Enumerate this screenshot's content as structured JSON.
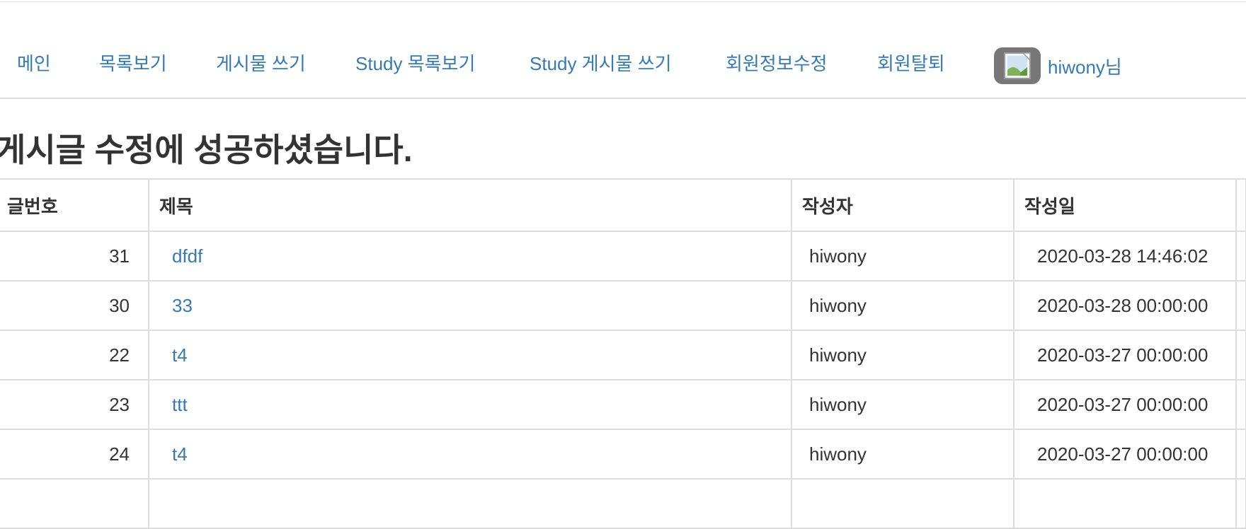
{
  "nav": {
    "items": [
      {
        "label": "메인"
      },
      {
        "label": "목록보기"
      },
      {
        "label": "게시물 쓰기"
      },
      {
        "label": "Study 목록보기"
      },
      {
        "label": "Study 게시물 쓰기"
      },
      {
        "label": "회원정보수정"
      },
      {
        "label": "회원탈퇴"
      }
    ],
    "user": {
      "name": "hiwony님",
      "avatar_icon": "broken-image-icon"
    }
  },
  "page": {
    "title": "게시글 수정에 성공하셨습니다."
  },
  "table": {
    "headers": {
      "num": "글번호",
      "title": "제목",
      "writer": "작성자",
      "date": "작성일"
    },
    "rows": [
      {
        "num": "31",
        "title": "dfdf",
        "writer": "hiwony",
        "date": "2020-03-28 14:46:02"
      },
      {
        "num": "30",
        "title": "33",
        "writer": "hiwony",
        "date": "2020-03-28 00:00:00"
      },
      {
        "num": "22",
        "title": "t4",
        "writer": "hiwony",
        "date": "2020-03-27 00:00:00"
      },
      {
        "num": "23",
        "title": "ttt",
        "writer": "hiwony",
        "date": "2020-03-27 00:00:00"
      },
      {
        "num": "24",
        "title": "t4",
        "writer": "hiwony",
        "date": "2020-03-27 00:00:00"
      },
      {
        "num": "",
        "title": "",
        "writer": "",
        "date": ""
      }
    ]
  },
  "colors": {
    "link": "#337ab7",
    "border": "#dddddd",
    "text": "#333333"
  }
}
